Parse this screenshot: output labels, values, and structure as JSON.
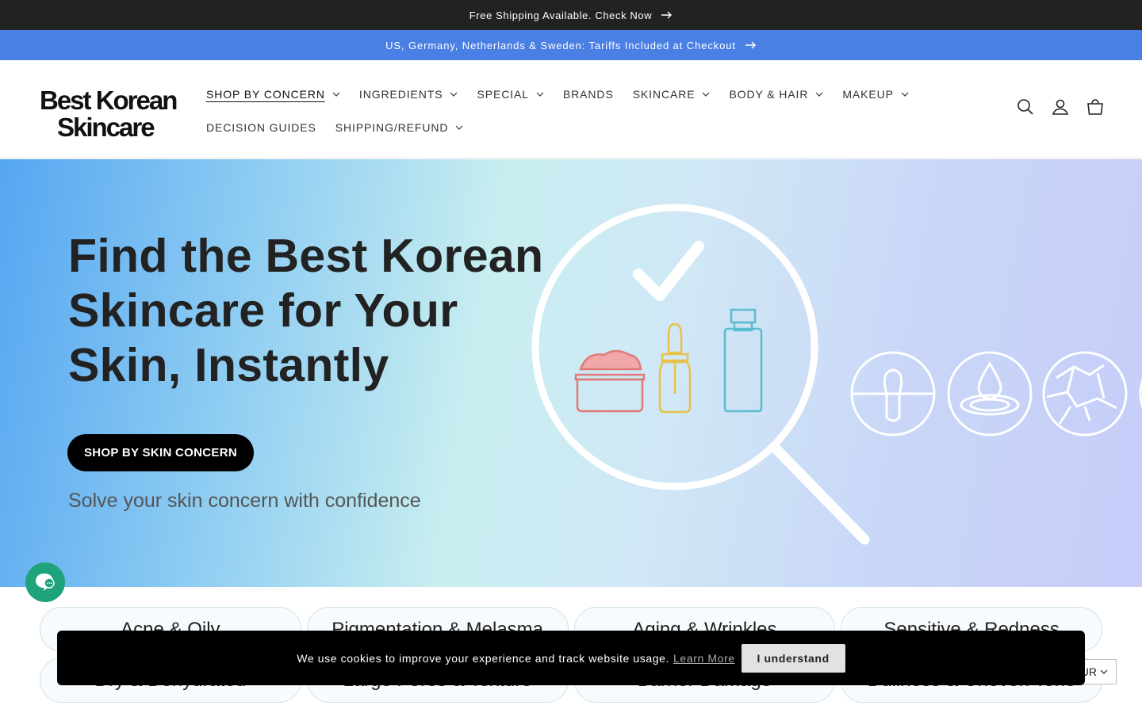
{
  "announcements": {
    "shipping": "Free Shipping Available. Check Now",
    "tariffs": "US, Germany, Netherlands & Sweden: Tariffs Included at Checkout"
  },
  "brand": {
    "line1": "Best Korean",
    "line2": "Skincare"
  },
  "nav": {
    "row1": [
      {
        "label": "SHOP BY CONCERN",
        "dropdown": true,
        "active": true
      },
      {
        "label": "INGREDIENTS",
        "dropdown": true
      },
      {
        "label": "SPECIAL",
        "dropdown": true
      },
      {
        "label": "BRANDS",
        "dropdown": false
      },
      {
        "label": "SKINCARE",
        "dropdown": true
      },
      {
        "label": "BODY & HAIR",
        "dropdown": true
      },
      {
        "label": "MAKEUP",
        "dropdown": true
      }
    ],
    "row2": [
      {
        "label": "DECISION GUIDES",
        "dropdown": false
      },
      {
        "label": "SHIPPING/REFUND",
        "dropdown": true
      }
    ]
  },
  "header_icons": [
    "search-icon",
    "account-icon",
    "cart-icon"
  ],
  "hero": {
    "title": "Find the Best Korean Skincare for Your Skin, Instantly",
    "button": "SHOP BY SKIN CONCERN",
    "subtitle": "Solve your skin concern with confidence"
  },
  "concerns": {
    "row1": [
      "Acne & Oily",
      "Pigmentation & Melasma",
      "Aging & Wrinkles",
      "Sensitive & Redness"
    ],
    "row2": [
      "Dry & Dehydrated",
      "Large Pores & Texture",
      "Barrier Damage",
      "Dullness & Uneven Tone"
    ]
  },
  "currency": {
    "label": "UR"
  },
  "cookie": {
    "message": "We use cookies to improve your experience and track website usage.",
    "learn_more": "Learn More",
    "accept": "I understand"
  },
  "colors": {
    "announcement_dark": "#222222",
    "announcement_blue": "#4a7fe3",
    "chat": "#1fa37c",
    "hero_button": "#000000"
  }
}
